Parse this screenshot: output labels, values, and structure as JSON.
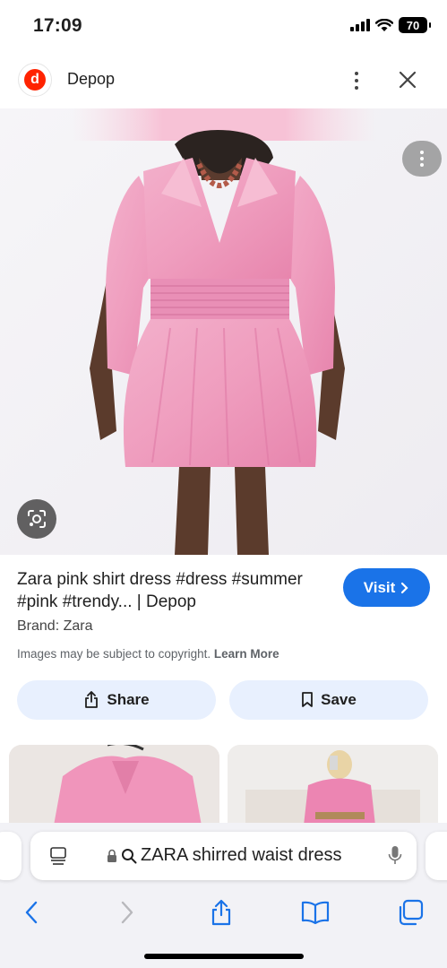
{
  "status_bar": {
    "time": "17:09",
    "battery": "70"
  },
  "site_header": {
    "logo_letter": "d",
    "site_name": "Depop"
  },
  "result": {
    "title": "Zara pink shirt dress #dress #summer #pink #trendy... | Depop",
    "visit_label": "Visit",
    "brand": "Brand: Zara",
    "copyright_text": "Images may be subject to copyright.",
    "learn_more": "Learn More",
    "share_label": "Share",
    "save_label": "Save"
  },
  "address_bar": {
    "query": "ZARA shirred waist dress"
  },
  "colors": {
    "accent": "#1a73e8",
    "button_bg": "#e8f0fe",
    "dress_pink": "#f0a4c4",
    "logo_red": "#ff2300"
  },
  "icons": [
    "signal-icon",
    "wifi-icon",
    "battery-icon",
    "more-vert-icon",
    "close-icon",
    "lens-icon",
    "share-icon",
    "bookmark-icon",
    "tab-menu-icon",
    "lock-icon",
    "search-icon",
    "mic-icon",
    "back-icon",
    "forward-icon",
    "bookmarks-icon",
    "tabs-icon"
  ]
}
